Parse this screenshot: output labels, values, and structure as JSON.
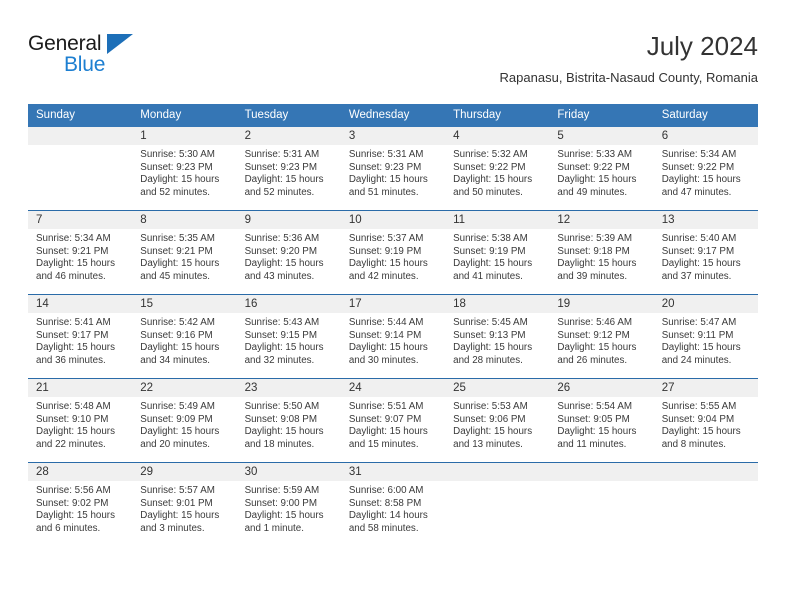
{
  "logo": {
    "primary_text": "General",
    "secondary_text": "Blue",
    "primary_color": "#1a1a1a",
    "secondary_color": "#1d7fd1",
    "triangle_color": "#1d6fb8"
  },
  "header": {
    "title": "July 2024",
    "subtitle": "Rapanasu, Bistrita-Nasaud County, Romania"
  },
  "theme": {
    "header_blue": "#3576b5",
    "rule_blue": "#2a6ba8",
    "daynum_band": "#f0f0f0",
    "text": "#333333"
  },
  "weekdays": [
    "Sunday",
    "Monday",
    "Tuesday",
    "Wednesday",
    "Thursday",
    "Friday",
    "Saturday"
  ],
  "weeks": [
    [
      {
        "day": ""
      },
      {
        "day": "1",
        "sunrise": "Sunrise: 5:30 AM",
        "sunset": "Sunset: 9:23 PM",
        "daylight": "Daylight: 15 hours and 52 minutes."
      },
      {
        "day": "2",
        "sunrise": "Sunrise: 5:31 AM",
        "sunset": "Sunset: 9:23 PM",
        "daylight": "Daylight: 15 hours and 52 minutes."
      },
      {
        "day": "3",
        "sunrise": "Sunrise: 5:31 AM",
        "sunset": "Sunset: 9:23 PM",
        "daylight": "Daylight: 15 hours and 51 minutes."
      },
      {
        "day": "4",
        "sunrise": "Sunrise: 5:32 AM",
        "sunset": "Sunset: 9:22 PM",
        "daylight": "Daylight: 15 hours and 50 minutes."
      },
      {
        "day": "5",
        "sunrise": "Sunrise: 5:33 AM",
        "sunset": "Sunset: 9:22 PM",
        "daylight": "Daylight: 15 hours and 49 minutes."
      },
      {
        "day": "6",
        "sunrise": "Sunrise: 5:34 AM",
        "sunset": "Sunset: 9:22 PM",
        "daylight": "Daylight: 15 hours and 47 minutes."
      }
    ],
    [
      {
        "day": "7",
        "sunrise": "Sunrise: 5:34 AM",
        "sunset": "Sunset: 9:21 PM",
        "daylight": "Daylight: 15 hours and 46 minutes."
      },
      {
        "day": "8",
        "sunrise": "Sunrise: 5:35 AM",
        "sunset": "Sunset: 9:21 PM",
        "daylight": "Daylight: 15 hours and 45 minutes."
      },
      {
        "day": "9",
        "sunrise": "Sunrise: 5:36 AM",
        "sunset": "Sunset: 9:20 PM",
        "daylight": "Daylight: 15 hours and 43 minutes."
      },
      {
        "day": "10",
        "sunrise": "Sunrise: 5:37 AM",
        "sunset": "Sunset: 9:19 PM",
        "daylight": "Daylight: 15 hours and 42 minutes."
      },
      {
        "day": "11",
        "sunrise": "Sunrise: 5:38 AM",
        "sunset": "Sunset: 9:19 PM",
        "daylight": "Daylight: 15 hours and 41 minutes."
      },
      {
        "day": "12",
        "sunrise": "Sunrise: 5:39 AM",
        "sunset": "Sunset: 9:18 PM",
        "daylight": "Daylight: 15 hours and 39 minutes."
      },
      {
        "day": "13",
        "sunrise": "Sunrise: 5:40 AM",
        "sunset": "Sunset: 9:17 PM",
        "daylight": "Daylight: 15 hours and 37 minutes."
      }
    ],
    [
      {
        "day": "14",
        "sunrise": "Sunrise: 5:41 AM",
        "sunset": "Sunset: 9:17 PM",
        "daylight": "Daylight: 15 hours and 36 minutes."
      },
      {
        "day": "15",
        "sunrise": "Sunrise: 5:42 AM",
        "sunset": "Sunset: 9:16 PM",
        "daylight": "Daylight: 15 hours and 34 minutes."
      },
      {
        "day": "16",
        "sunrise": "Sunrise: 5:43 AM",
        "sunset": "Sunset: 9:15 PM",
        "daylight": "Daylight: 15 hours and 32 minutes."
      },
      {
        "day": "17",
        "sunrise": "Sunrise: 5:44 AM",
        "sunset": "Sunset: 9:14 PM",
        "daylight": "Daylight: 15 hours and 30 minutes."
      },
      {
        "day": "18",
        "sunrise": "Sunrise: 5:45 AM",
        "sunset": "Sunset: 9:13 PM",
        "daylight": "Daylight: 15 hours and 28 minutes."
      },
      {
        "day": "19",
        "sunrise": "Sunrise: 5:46 AM",
        "sunset": "Sunset: 9:12 PM",
        "daylight": "Daylight: 15 hours and 26 minutes."
      },
      {
        "day": "20",
        "sunrise": "Sunrise: 5:47 AM",
        "sunset": "Sunset: 9:11 PM",
        "daylight": "Daylight: 15 hours and 24 minutes."
      }
    ],
    [
      {
        "day": "21",
        "sunrise": "Sunrise: 5:48 AM",
        "sunset": "Sunset: 9:10 PM",
        "daylight": "Daylight: 15 hours and 22 minutes."
      },
      {
        "day": "22",
        "sunrise": "Sunrise: 5:49 AM",
        "sunset": "Sunset: 9:09 PM",
        "daylight": "Daylight: 15 hours and 20 minutes."
      },
      {
        "day": "23",
        "sunrise": "Sunrise: 5:50 AM",
        "sunset": "Sunset: 9:08 PM",
        "daylight": "Daylight: 15 hours and 18 minutes."
      },
      {
        "day": "24",
        "sunrise": "Sunrise: 5:51 AM",
        "sunset": "Sunset: 9:07 PM",
        "daylight": "Daylight: 15 hours and 15 minutes."
      },
      {
        "day": "25",
        "sunrise": "Sunrise: 5:53 AM",
        "sunset": "Sunset: 9:06 PM",
        "daylight": "Daylight: 15 hours and 13 minutes."
      },
      {
        "day": "26",
        "sunrise": "Sunrise: 5:54 AM",
        "sunset": "Sunset: 9:05 PM",
        "daylight": "Daylight: 15 hours and 11 minutes."
      },
      {
        "day": "27",
        "sunrise": "Sunrise: 5:55 AM",
        "sunset": "Sunset: 9:04 PM",
        "daylight": "Daylight: 15 hours and 8 minutes."
      }
    ],
    [
      {
        "day": "28",
        "sunrise": "Sunrise: 5:56 AM",
        "sunset": "Sunset: 9:02 PM",
        "daylight": "Daylight: 15 hours and 6 minutes."
      },
      {
        "day": "29",
        "sunrise": "Sunrise: 5:57 AM",
        "sunset": "Sunset: 9:01 PM",
        "daylight": "Daylight: 15 hours and 3 minutes."
      },
      {
        "day": "30",
        "sunrise": "Sunrise: 5:59 AM",
        "sunset": "Sunset: 9:00 PM",
        "daylight": "Daylight: 15 hours and 1 minute."
      },
      {
        "day": "31",
        "sunrise": "Sunrise: 6:00 AM",
        "sunset": "Sunset: 8:58 PM",
        "daylight": "Daylight: 14 hours and 58 minutes."
      },
      {
        "day": ""
      },
      {
        "day": ""
      },
      {
        "day": ""
      }
    ]
  ]
}
